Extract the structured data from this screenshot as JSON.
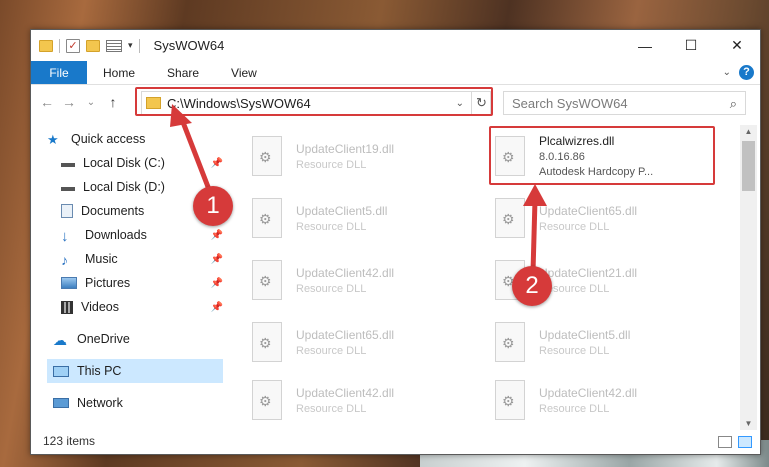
{
  "window": {
    "title": "SysWOW64",
    "minimize_glyph": "—",
    "maximize_glyph": "☐",
    "close_glyph": "✕"
  },
  "ribbon": {
    "file_label": "File",
    "tabs": [
      "Home",
      "Share",
      "View"
    ],
    "help_glyph": "?"
  },
  "nav": {
    "back_glyph": "←",
    "forward_glyph": "→",
    "recent_glyph": "⌄",
    "up_glyph": "↑",
    "address": "C:\\Windows\\SysWOW64",
    "refresh_glyph": "↻",
    "search_placeholder": "Search SysWOW64"
  },
  "sidebar": {
    "items": [
      {
        "label": "Quick access",
        "icon": "star-icon"
      },
      {
        "label": "Local Disk (C:)",
        "icon": "drive-icon"
      },
      {
        "label": "Local Disk (D:)",
        "icon": "drive-icon"
      },
      {
        "label": "Documents",
        "icon": "documents-icon"
      },
      {
        "label": "Downloads",
        "icon": "download-icon"
      },
      {
        "label": "Music",
        "icon": "music-icon"
      },
      {
        "label": "Pictures",
        "icon": "pictures-icon"
      },
      {
        "label": "Videos",
        "icon": "videos-icon"
      },
      {
        "label": "OneDrive",
        "icon": "cloud-icon"
      },
      {
        "label": "This PC",
        "icon": "computer-icon"
      },
      {
        "label": "Network",
        "icon": "network-icon"
      }
    ]
  },
  "files": {
    "left_column": [
      {
        "name": "UpdateClient19.dll",
        "type": "Resource DLL"
      },
      {
        "name": "UpdateClient5.dll",
        "type": "Resource DLL"
      },
      {
        "name": "UpdateClient42.dll",
        "type": "Resource DLL"
      },
      {
        "name": "UpdateClient65.dll",
        "type": "Resource DLL"
      },
      {
        "name": "UpdateClient42.dll",
        "type": "Resource DLL"
      }
    ],
    "right_column": [
      {
        "name": "UpdateClient65.dll",
        "type": "Resource DLL"
      },
      {
        "name": "UpdateClient21.dll",
        "type": "Resource DLL"
      },
      {
        "name": "UpdateClient5.dll",
        "type": "Resource DLL"
      },
      {
        "name": "UpdateClient42.dll",
        "type": "Resource DLL"
      }
    ],
    "target": {
      "name": "Plcalwizres.dll",
      "version": "8.0.16.86",
      "description": "Autodesk Hardcopy P..."
    }
  },
  "status": {
    "item_count": "123 items"
  },
  "annotations": {
    "badge1": "1",
    "badge2": "2",
    "color": "#d63a3a"
  }
}
